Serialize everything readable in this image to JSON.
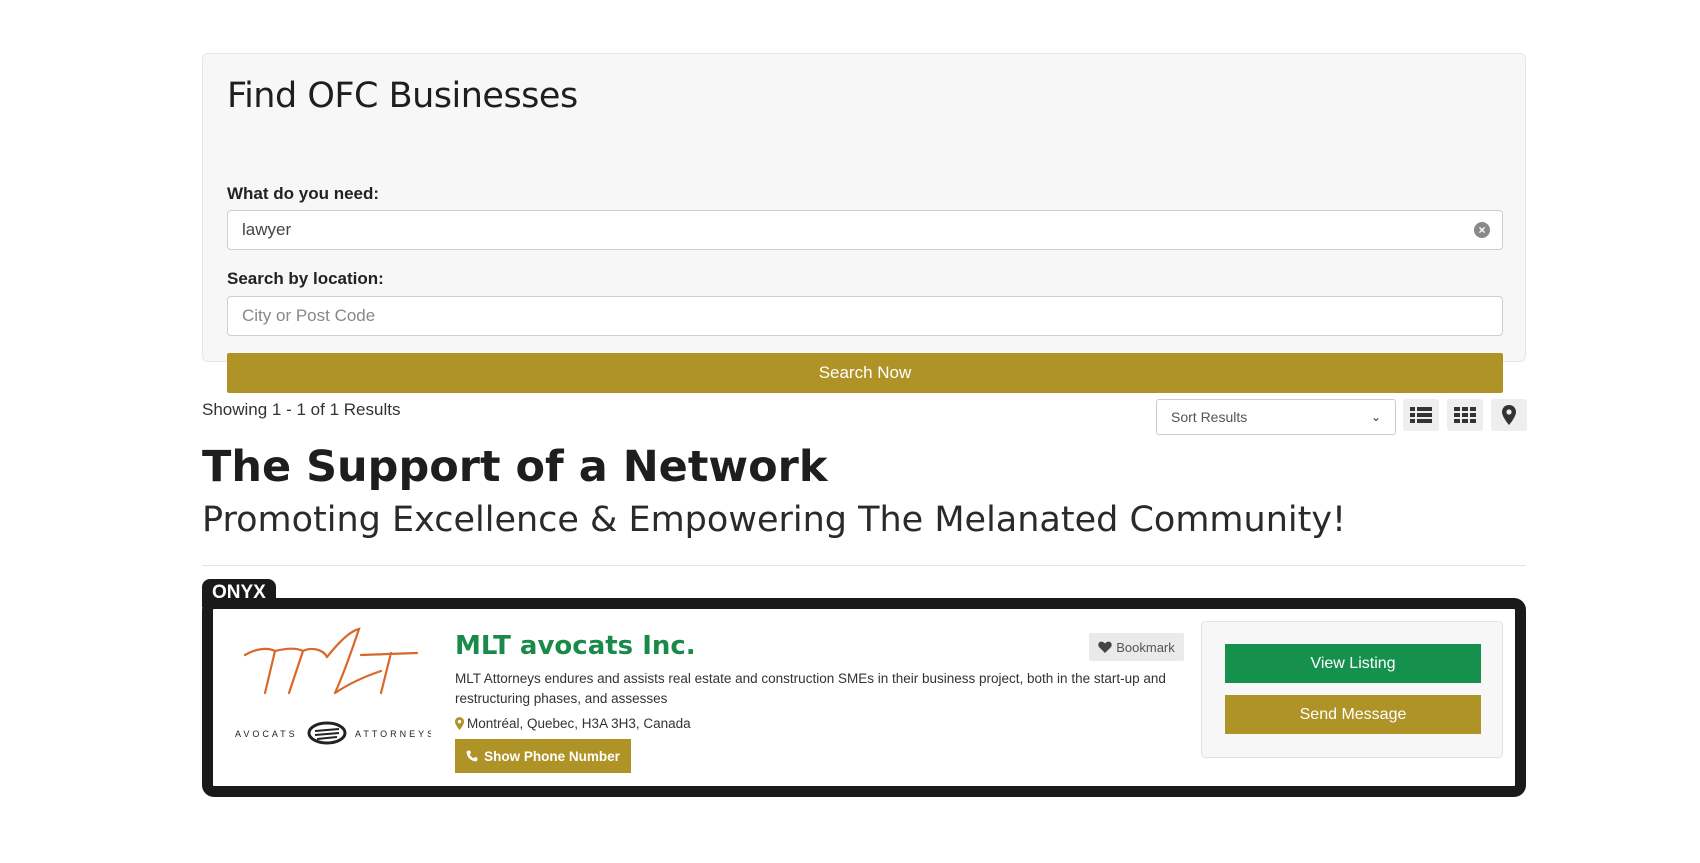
{
  "search_panel": {
    "title": "Find OFC Businesses",
    "need_label": "What do you need:",
    "need_value": "lawyer",
    "location_label": "Search by location:",
    "location_placeholder": "City or Post Code",
    "search_button": "Search Now"
  },
  "results": {
    "count_text": "Showing 1 - 1 of 1 Results",
    "sort_label": "Sort Results",
    "view_icons": [
      "list-view-icon",
      "grid-view-icon",
      "map-pin-icon"
    ]
  },
  "headline": {
    "title": "The Support of a Network",
    "subtitle": "Promoting Excellence & Empowering The Melanated Community!"
  },
  "listing": {
    "tier_badge": "ONYX",
    "logo": {
      "left_text": "AVOCATS",
      "right_text": "ATTORNEYS",
      "monogram": "MLT"
    },
    "name": "MLT avocats Inc.",
    "bookmark_label": "Bookmark",
    "description": "MLT Attorneys endures and assists real estate and construction SMEs in their business project, both in the start-up and restructuring phases, and assesses",
    "location": "Montréal, Quebec, H3A 3H3, Canada",
    "phone_button": "Show Phone Number",
    "view_listing_button": "View Listing",
    "send_message_button": "Send Message"
  },
  "colors": {
    "gold": "#b09327",
    "green": "#16914d",
    "dark": "#1a1a1a"
  }
}
